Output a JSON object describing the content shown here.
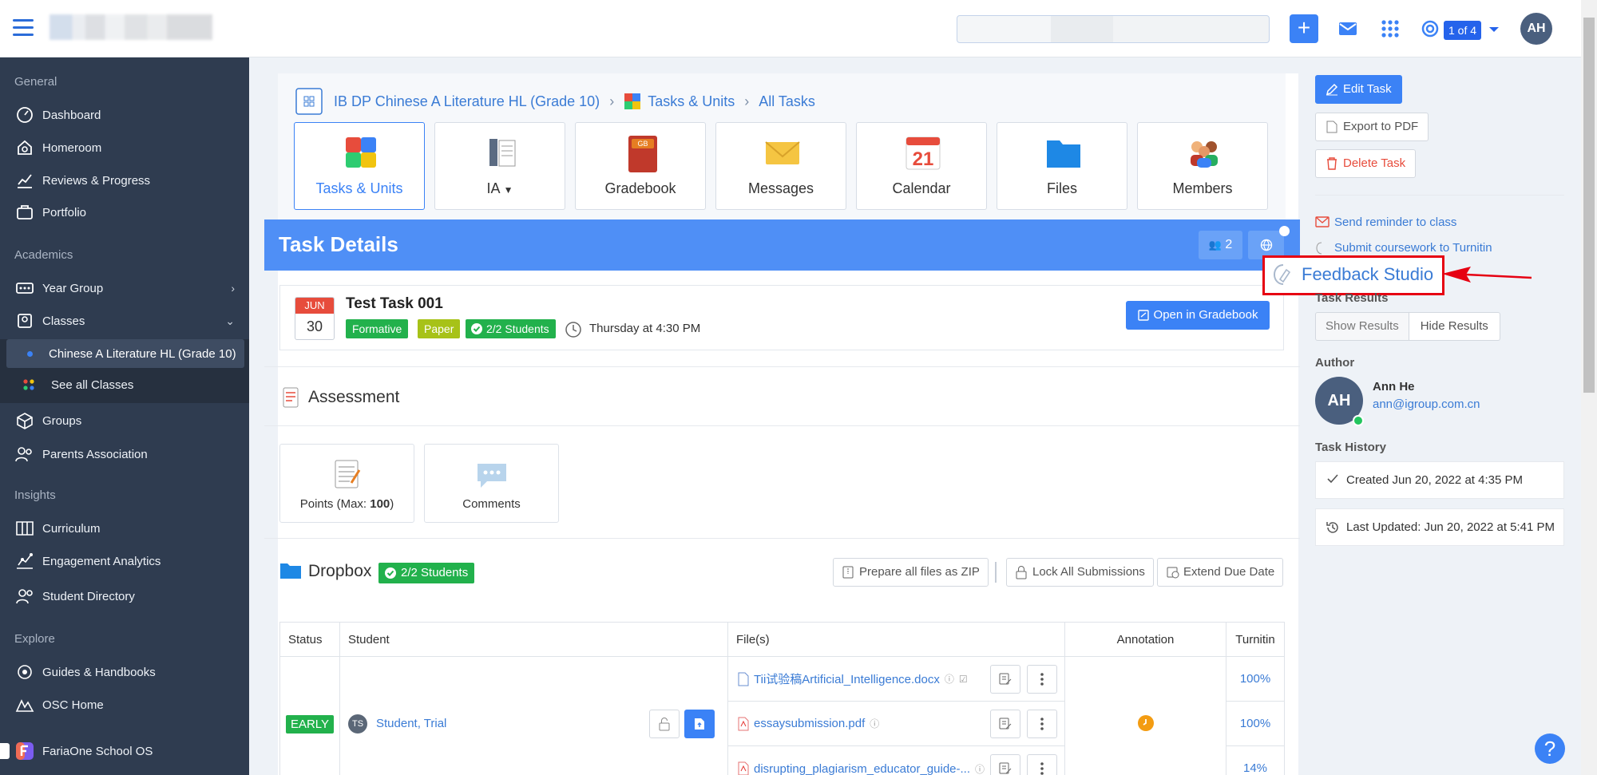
{
  "topbar": {
    "page_indicator": "1 of 4",
    "avatar_initials": "AH"
  },
  "sidebar": {
    "sections": {
      "general": "General",
      "academics": "Academics",
      "insights": "Insights",
      "explore": "Explore"
    },
    "items": {
      "dashboard": "Dashboard",
      "homeroom": "Homeroom",
      "reviews": "Reviews & Progress",
      "portfolio": "Portfolio",
      "year_group": "Year Group",
      "classes": "Classes",
      "active_class": "Chinese A Literature HL (Grade 10)",
      "see_all": "See all Classes",
      "groups": "Groups",
      "parents": "Parents Association",
      "curriculum": "Curriculum",
      "engagement": "Engagement Analytics",
      "student_dir": "Student Directory",
      "guides": "Guides & Handbooks",
      "osc": "OSC Home",
      "fariaone": "FariaOne School OS"
    }
  },
  "breadcrumb": {
    "course": "IB DP Chinese A Literature HL (Grade 10)",
    "tasks": "Tasks & Units",
    "all": "All Tasks"
  },
  "tiles": [
    "Tasks & Units",
    "IA",
    "Gradebook",
    "Messages",
    "Calendar",
    "Files",
    "Members"
  ],
  "task_header": {
    "title": "Task Details",
    "members_count": "2"
  },
  "task": {
    "month": "JUN",
    "day": "30",
    "name": "Test Task 001",
    "badges": {
      "formative": "Formative",
      "paper": "Paper",
      "students": "2/2 Students"
    },
    "due": "Thursday at 4:30 PM",
    "gradebook_btn": "Open in Gradebook"
  },
  "assessment": {
    "title": "Assessment",
    "points_prefix": "Points (Max: ",
    "points_max": "100",
    "points_suffix": ")",
    "comments": "Comments"
  },
  "dropbox": {
    "title": "Dropbox",
    "badge": "2/2 Students",
    "zip_btn": "Prepare all files as ZIP",
    "lock_btn": "Lock All Submissions",
    "extend_btn": "Extend Due Date",
    "columns": [
      "Status",
      "Student",
      "File(s)",
      "Annotation",
      "Turnitin"
    ],
    "row": {
      "status": "EARLY",
      "initials": "TS",
      "student": "Student, Trial",
      "files": [
        "Tii试验稿Artificial_Intelligence.docx",
        "essaysubmission.pdf",
        "disrupting_plagiarism_educator_guide-..."
      ],
      "turnitin": [
        "100%",
        "100%",
        "14%"
      ]
    }
  },
  "right": {
    "edit": "Edit Task",
    "export": "Export to PDF",
    "delete": "Delete Task",
    "reminder": "Send reminder to class",
    "submit_tii": "Submit coursework to Turnitin",
    "feedback": "Feedback Studio",
    "results_label": "Task Results",
    "show_results": "Show Results",
    "hide_results": "Hide Results",
    "author_label": "Author",
    "author_initials": "AH",
    "author_name": "Ann He",
    "author_email": "ann@igroup.com.cn",
    "history_label": "Task History",
    "created": "Created Jun 20, 2022 at 4:35 PM",
    "updated": "Last Updated: Jun 20, 2022 at 5:41 PM"
  },
  "colors": {
    "accent": "#3b82f6",
    "sidebar": "#2f3c50",
    "success": "#22b14c",
    "annotation_red": "#e60012"
  }
}
